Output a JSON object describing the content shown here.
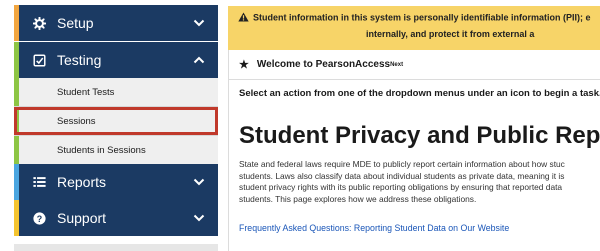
{
  "sidebar": {
    "setup": {
      "label": "Setup",
      "icon": "gear-icon",
      "chevron": "chevron-down-icon",
      "accent": "#f2a640"
    },
    "testing": {
      "label": "Testing",
      "icon": "checkbox-icon",
      "chevron": "chevron-up-icon",
      "accent": "#8dc544",
      "items": [
        {
          "label": "Student Tests"
        },
        {
          "label": "Sessions",
          "selected": true
        },
        {
          "label": "Students in Sessions"
        }
      ]
    },
    "reports": {
      "label": "Reports",
      "icon": "reports-icon",
      "chevron": "chevron-down-icon",
      "accent": "#4aa5e0"
    },
    "support": {
      "label": "Support",
      "icon": "question-icon",
      "chevron": "chevron-down-icon",
      "accent": "#f4c430"
    }
  },
  "banner": {
    "line1": "Student information in this system is personally identifiable information (PII); e",
    "line2": "internally, and protect it from external a"
  },
  "welcome": {
    "title": "Welcome to PearsonAccess",
    "superscript": "Next"
  },
  "main": {
    "instruction": "Select an action from one of the dropdown menus under an icon to begin a task.",
    "heading": "Student Privacy and Public Reports",
    "paragraph_lines": [
      "State and federal laws require MDE to publicly report certain information about how stuc",
      "students. Laws also classify data about individual students as private data, meaning it is",
      "student privacy rights with its public reporting obligations by ensuring that reported data",
      "students. This page explores how we address these obligations."
    ],
    "faq_link": "Frequently Asked Questions: Reporting Student Data on Our Website"
  },
  "colors": {
    "nav_bg": "#1b3a63",
    "banner_bg": "#f7d468",
    "selected_outline": "#c0392b",
    "link": "#1a56b8"
  }
}
